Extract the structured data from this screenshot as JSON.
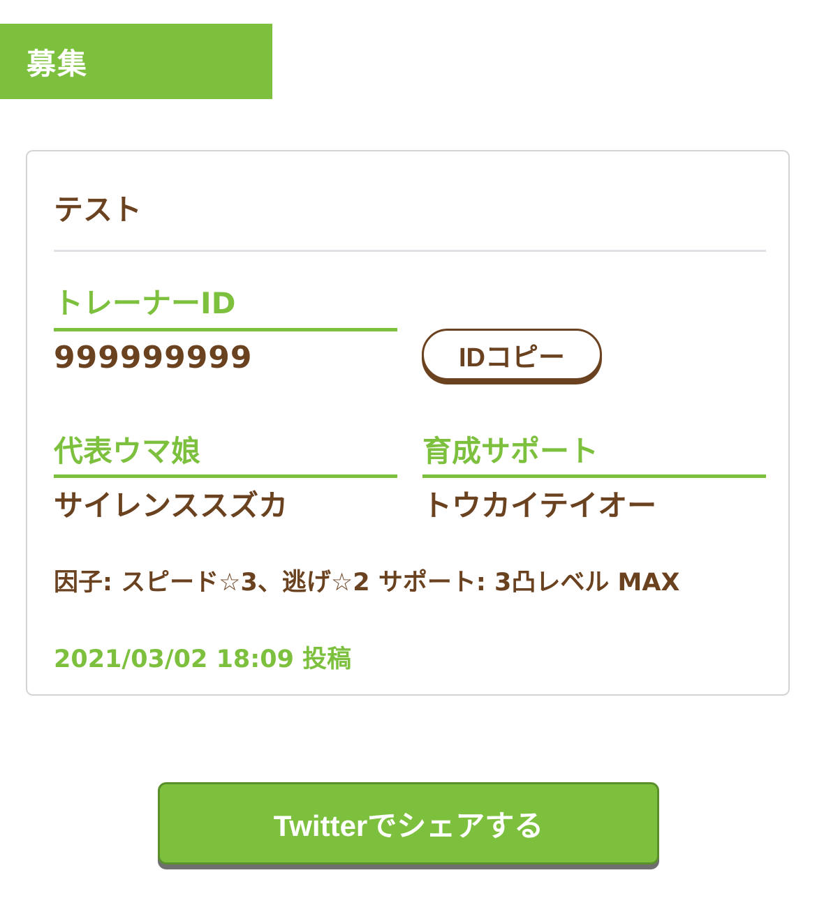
{
  "header": {
    "title": "募集"
  },
  "post": {
    "title": "テスト",
    "trainer_id_label": "トレーナーID",
    "trainer_id_value": "999999999",
    "copy_button_label": "IDコピー",
    "representative_label": "代表ウマ娘",
    "representative_value": "サイレンススズカ",
    "support_label": "育成サポート",
    "support_value": "トウカイテイオー",
    "body": "因子: スピード☆3、逃げ☆2 サポート: 3凸レベル MAX",
    "posted_at": "2021/03/02 18:09 投稿"
  },
  "share": {
    "label": "Twitterでシェアする"
  },
  "colors": {
    "accent": "#7dc03e",
    "text_brown": "#6b4220",
    "border": "#d4d4d8"
  }
}
